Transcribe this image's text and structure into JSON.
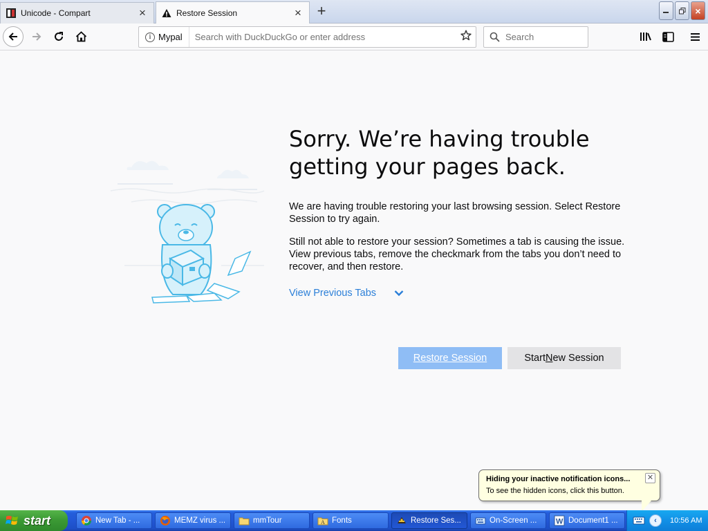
{
  "tabs": [
    {
      "title": "Unicode - Compart",
      "favicon": "compart-logo-icon",
      "active": false
    },
    {
      "title": "Restore Session",
      "favicon": "warning-icon",
      "active": true
    }
  ],
  "navbar": {
    "identity_label": "Mypal",
    "address_placeholder": "Search with DuckDuckGo or enter address",
    "search_placeholder": "Search"
  },
  "content": {
    "headline": "Sorry. We’re having trouble getting your pages back.",
    "para1": "We are having trouble restoring your last browsing session. Select Restore Session to try again.",
    "para2": "Still not able to restore your session? Sometimes a tab is causing the issue. View previous tabs, remove the checkmark from the tabs you don’t need to recover, and then restore.",
    "view_tabs_link": "View Previous Tabs",
    "restore_button": "Restore Session",
    "new_session_pre": "Start ",
    "new_session_accel": "N",
    "new_session_post": "ew Session"
  },
  "balloon": {
    "title": "Hiding your inactive notification icons...",
    "text": "To see the hidden icons, click this button."
  },
  "taskbar": {
    "start_label": "start",
    "items": [
      {
        "label": "New Tab - ...",
        "icon": "chrome-icon"
      },
      {
        "label": "MEMZ virus ...",
        "icon": "firefox-icon"
      },
      {
        "label": "mmTour",
        "icon": "folder-icon"
      },
      {
        "label": "Fonts",
        "icon": "fonts-folder-icon"
      },
      {
        "label": "Restore Ses...",
        "icon": "mypal-icon",
        "active": true
      },
      {
        "label": "On-Screen ...",
        "icon": "keyboard-icon"
      },
      {
        "label": "Document1 ...",
        "icon": "word-icon"
      }
    ],
    "clock": "10:56 AM"
  },
  "colors": {
    "link": "#2b7fd8",
    "restore_button_bg": "#8fbdf5",
    "new_session_bg": "#e3e3e5",
    "taskbar_blue": "#245edb",
    "start_green": "#3c9a35",
    "balloon_bg": "#ffffe1"
  }
}
